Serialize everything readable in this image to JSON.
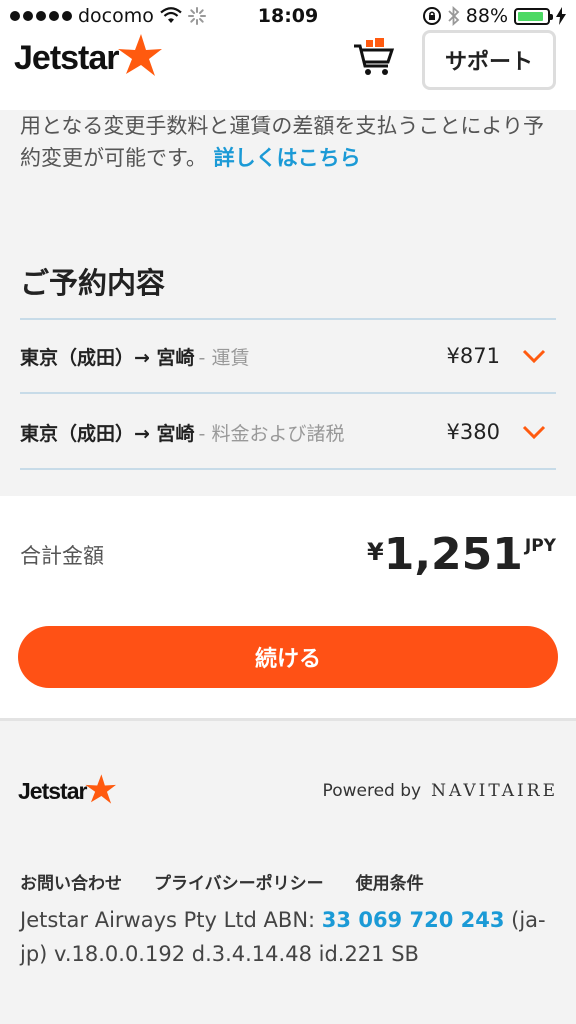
{
  "status_bar": {
    "carrier": "docomo",
    "time": "18:09",
    "battery": "88%",
    "battery_level": 0.88
  },
  "header": {
    "logo": "Jetstar",
    "support_label": "サポート"
  },
  "info": {
    "text": "用となる変更手数料と運賃の差額を支払うことにより予約変更が可能です。",
    "link": "詳しくはこちら"
  },
  "booking": {
    "title": "ご予約内容",
    "rows": [
      {
        "route": "東京（成田）→ 宮崎",
        "desc": "- 運賃",
        "price": "¥871"
      },
      {
        "route": "東京（成田）→ 宮崎",
        "desc": "- 料金および諸税",
        "price": "¥380"
      }
    ]
  },
  "total": {
    "label": "合計金額",
    "currency_symbol": "¥",
    "amount": "1,251",
    "currency": "JPY"
  },
  "continue_label": "続ける",
  "footer": {
    "logo": "Jetstar",
    "powered_by": "Powered by",
    "navitaire": "NAVITAIRE",
    "links": [
      "お問い合わせ",
      "プライバシーポリシー",
      "使用条件"
    ],
    "company_prefix": "Jetstar Airways Pty Ltd ABN: ",
    "abn": "33 069 720 243",
    "company_suffix": " (ja-jp) v.18.0.0.192 d.3.4.14.48 id.221 SB"
  },
  "colors": {
    "accent": "#ff5115",
    "link": "#1b9ad6",
    "divider": "#c7dbe8"
  },
  "icons": [
    "wifi-icon",
    "loading-icon",
    "lock-rotation-icon",
    "bluetooth-icon",
    "charging-icon",
    "cart-icon",
    "chevron-down-icon",
    "star-icon"
  ]
}
